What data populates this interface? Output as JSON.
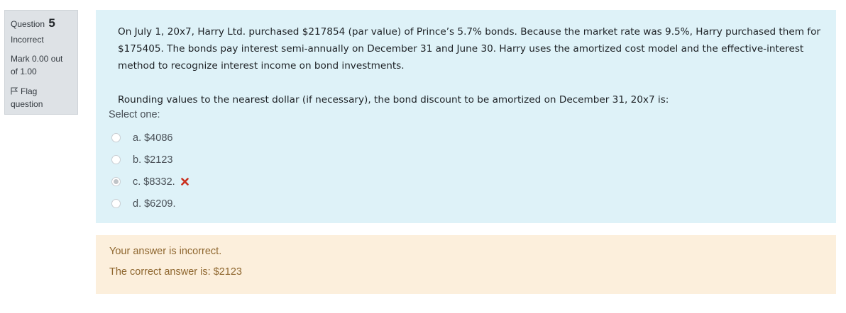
{
  "info": {
    "question_label": "Question",
    "question_number": "5",
    "state": "Incorrect",
    "grade": "Mark 0.00 out of 1.00",
    "flag_label": "Flag question"
  },
  "question": {
    "paragraph1": "On July 1, 20x7, Harry Ltd. purchased $217854 (par value) of Prince’s 5.7% bonds. Because the market rate was 9.5%, Harry purchased them for $175405. The bonds pay interest semi-annually on December 31 and June 30. Harry uses the amortized cost model and the effective-interest method to recognize interest income on bond investments.",
    "paragraph2": "Rounding values to the nearest dollar (if necessary), the bond discount to be amortized on December 31, 20x7 is:",
    "prompt": "Select one:",
    "options": [
      {
        "label": "a. $4086",
        "selected": false,
        "marked_incorrect": false
      },
      {
        "label": "b. $2123",
        "selected": false,
        "marked_incorrect": false
      },
      {
        "label": "c. $8332.",
        "selected": true,
        "marked_incorrect": true
      },
      {
        "label": "d. $6209.",
        "selected": false,
        "marked_incorrect": false
      }
    ]
  },
  "feedback": {
    "status": "Your answer is incorrect.",
    "correct_answer": "The correct answer is: $2123"
  },
  "colors": {
    "question_bg": "#def2f8",
    "feedback_bg": "#fcefdc",
    "feedback_text": "#8e662e",
    "incorrect_icon": "#ca3120",
    "info_bg": "#dee2e6"
  },
  "icons": {
    "flag": "flag-icon",
    "incorrect": "times-icon"
  }
}
